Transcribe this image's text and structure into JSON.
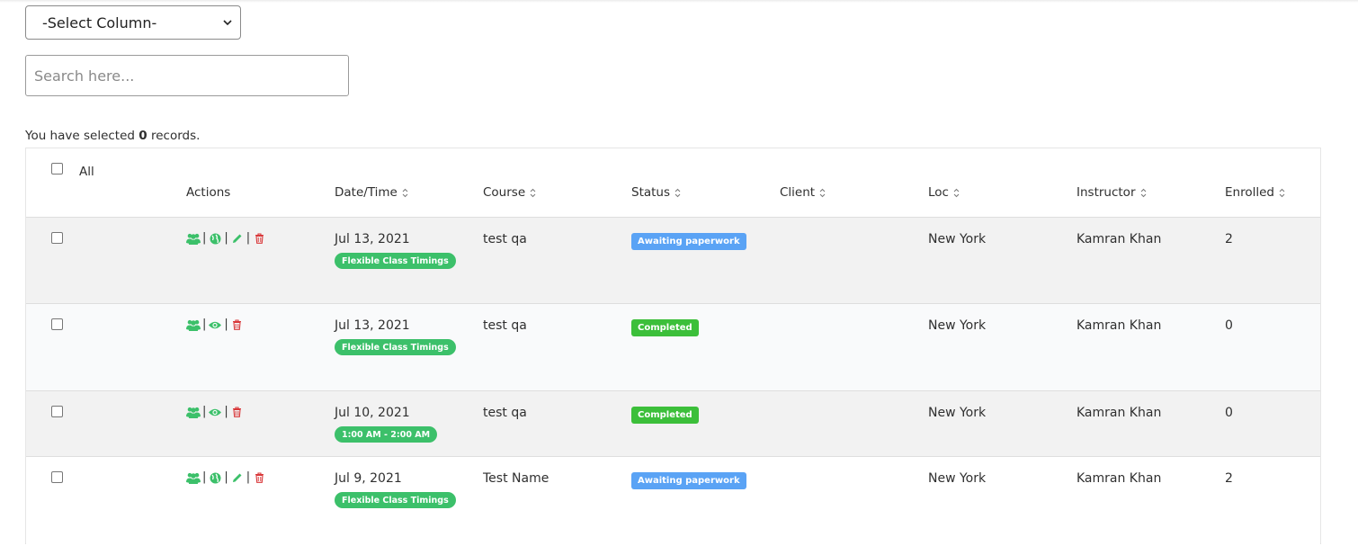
{
  "filter": {
    "select_column": "-Select Column-",
    "search_placeholder": "Search here..."
  },
  "selection": {
    "prefix": "You have selected",
    "count": "0",
    "suffix": "records."
  },
  "table": {
    "all_label": "All",
    "headers": [
      "Actions",
      "Date/Time",
      "Course",
      "Status",
      "Client",
      "Loc",
      "Instructor",
      "Enrolled"
    ],
    "rows": [
      {
        "date": "Jul 13, 2021",
        "time": "Flexible Class Timings",
        "course": "test qa",
        "status": "Awaiting paperwork",
        "client": "",
        "loc": "New York",
        "instructor": "Kamran Khan",
        "enrolled": "2"
      },
      {
        "date": "Jul 13, 2021",
        "time": "Flexible Class Timings",
        "course": "test qa",
        "status": "Completed",
        "client": "",
        "loc": "New York",
        "instructor": "Kamran Khan",
        "enrolled": "0"
      },
      {
        "date": "Jul 10, 2021",
        "time": "1:00 AM - 2:00 AM",
        "course": "test qa",
        "status": "Completed",
        "client": "",
        "loc": "New York",
        "instructor": "Kamran Khan",
        "enrolled": "0"
      },
      {
        "date": "Jul 9, 2021",
        "time": "Flexible Class Timings",
        "course": "Test Name",
        "status": "Awaiting paperwork",
        "client": "",
        "loc": "New York",
        "instructor": "Kamran Khan",
        "enrolled": "2"
      }
    ]
  },
  "icons": {
    "group": "users-icon",
    "globe": "globe-icon",
    "eye": "eye-icon",
    "edit": "pencil-icon",
    "delete": "trash-icon",
    "sort": "sort-icon"
  },
  "colors": {
    "green": "#3cc06a",
    "status_awaiting": "#5aa3f5",
    "status_completed": "#3cbf3a",
    "delete_red": "#d9383a"
  }
}
